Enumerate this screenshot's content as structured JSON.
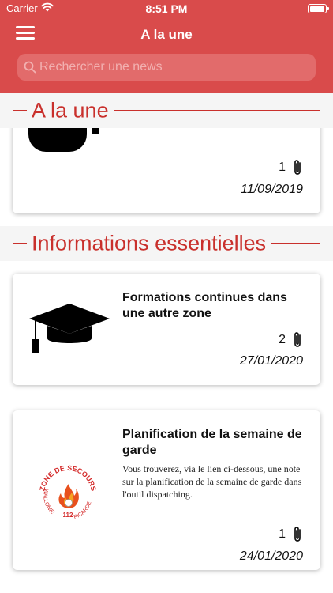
{
  "status_bar": {
    "carrier": "Carrier",
    "time": "8:51 PM",
    "battery_level": 0.95
  },
  "header": {
    "title": "A la une"
  },
  "search": {
    "placeholder": "Rechercher une news"
  },
  "sections": [
    {
      "title": "A la une"
    },
    {
      "title": "Informations essentielles"
    }
  ],
  "cards": [
    {
      "attachments": "1",
      "date": "11/09/2019",
      "icon": "partial-image"
    },
    {
      "title": "Formations continues dans une autre zone",
      "attachments": "2",
      "date": "27/01/2020",
      "icon": "graduation-cap-icon"
    },
    {
      "title": "Planification de la semaine de garde",
      "description": "Vous trouverez, via le lien ci-dessous, une note sur la planification de la semaine de garde dans l'outil dispatching.",
      "attachments": "1",
      "date": "24/01/2020",
      "logo": {
        "top": "ZONE DE SECOURS",
        "left": "WALLONIE",
        "number": "112",
        "right": "PICARDE"
      }
    }
  ],
  "colors": {
    "header": "#d94b4b",
    "search": "#e26b6b",
    "accent": "#c9302c",
    "section_bg": "#f5f5f5"
  }
}
